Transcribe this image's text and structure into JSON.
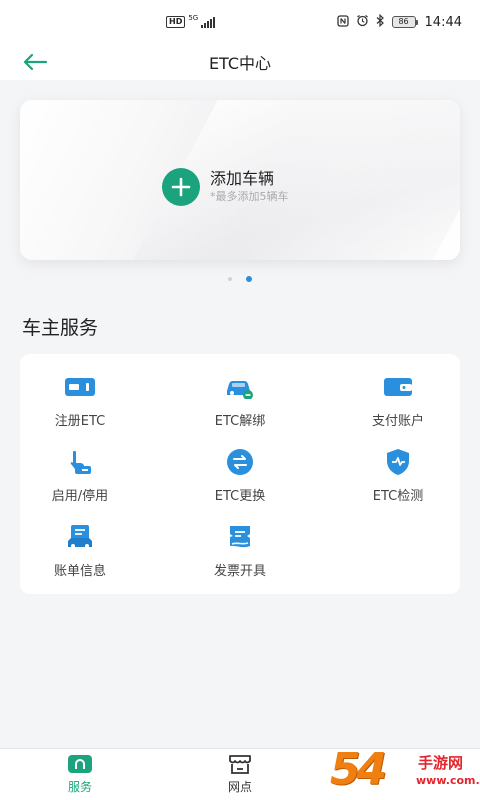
{
  "status_bar": {
    "hd": "HD",
    "network": "5G",
    "battery": "86",
    "time": "14:44"
  },
  "header": {
    "title": "ETC中心",
    "back_icon": "arrow-left-icon"
  },
  "vehicle_card": {
    "add_title": "添加车辆",
    "add_subtitle": "*最多添加5辆车",
    "carousel_active_index": 1,
    "carousel_count": 2
  },
  "services": {
    "section_title": "车主服务",
    "items": [
      {
        "label": "注册ETC",
        "icon": "etc-card-icon"
      },
      {
        "label": "ETC解绑",
        "icon": "car-unbind-icon"
      },
      {
        "label": "支付账户",
        "icon": "wallet-icon"
      },
      {
        "label": "启用/停用",
        "icon": "hand-tap-icon"
      },
      {
        "label": "ETC更换",
        "icon": "swap-icon"
      },
      {
        "label": "ETC检测",
        "icon": "shield-check-icon"
      },
      {
        "label": "账单信息",
        "icon": "bill-icon"
      },
      {
        "label": "发票开具",
        "icon": "invoice-icon"
      }
    ]
  },
  "bottom_nav": {
    "items": [
      {
        "label": "服务",
        "active": true,
        "icon": "home-icon"
      },
      {
        "label": "网点",
        "active": false,
        "icon": "store-icon"
      }
    ]
  },
  "watermark": {
    "number": "54",
    "brand": "手游网",
    "url": "www.com.cn"
  },
  "colors": {
    "accent_green": "#1aa37c",
    "icon_blue": "#2a8fdc",
    "background": "#f4f5f7"
  }
}
